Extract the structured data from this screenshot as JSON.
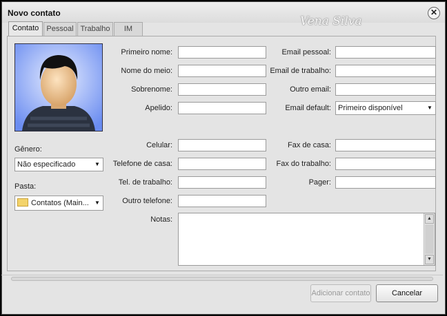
{
  "window": {
    "title": "Novo contato",
    "watermark": "Vena Silva",
    "close_glyph": "✕"
  },
  "tabs": [
    {
      "label": "Contato",
      "active": true
    },
    {
      "label": "Pessoal",
      "active": false
    },
    {
      "label": "Trabalho",
      "active": false
    },
    {
      "label": "IM",
      "active": false
    }
  ],
  "left": {
    "gender_label": "Gênero:",
    "gender_value": "Não especificado",
    "folder_label": "Pasta:",
    "folder_value": "Contatos (Main..."
  },
  "name_fields": {
    "first_name": {
      "label": "Primeiro nome:",
      "value": ""
    },
    "middle_name": {
      "label": "Nome do meio:",
      "value": ""
    },
    "surname": {
      "label": "Sobrenome:",
      "value": ""
    },
    "nickname": {
      "label": "Apelido:",
      "value": ""
    }
  },
  "email_fields": {
    "personal": {
      "label": "Email pessoal:",
      "value": ""
    },
    "work": {
      "label": "Email de trabalho:",
      "value": ""
    },
    "other": {
      "label": "Outro email:",
      "value": ""
    },
    "default": {
      "label": "Email default:",
      "value": "Primeiro disponível"
    }
  },
  "phone_fields": {
    "mobile": {
      "label": "Celular:",
      "value": ""
    },
    "home": {
      "label": "Telefone de casa:",
      "value": ""
    },
    "work": {
      "label": "Tel. de trabalho:",
      "value": ""
    },
    "other": {
      "label": "Outro telefone:",
      "value": ""
    }
  },
  "fax_fields": {
    "home": {
      "label": "Fax de casa:",
      "value": ""
    },
    "work": {
      "label": "Fax do trabalho:",
      "value": ""
    },
    "pager": {
      "label": "Pager:",
      "value": ""
    }
  },
  "notes": {
    "label": "Notas:",
    "value": ""
  },
  "buttons": {
    "add": "Adicionar contato",
    "cancel": "Cancelar"
  },
  "icons": {
    "close": "close-icon",
    "dropdown": "chevron-down-icon",
    "folder": "folder-icon",
    "avatar": "avatar-icon"
  }
}
